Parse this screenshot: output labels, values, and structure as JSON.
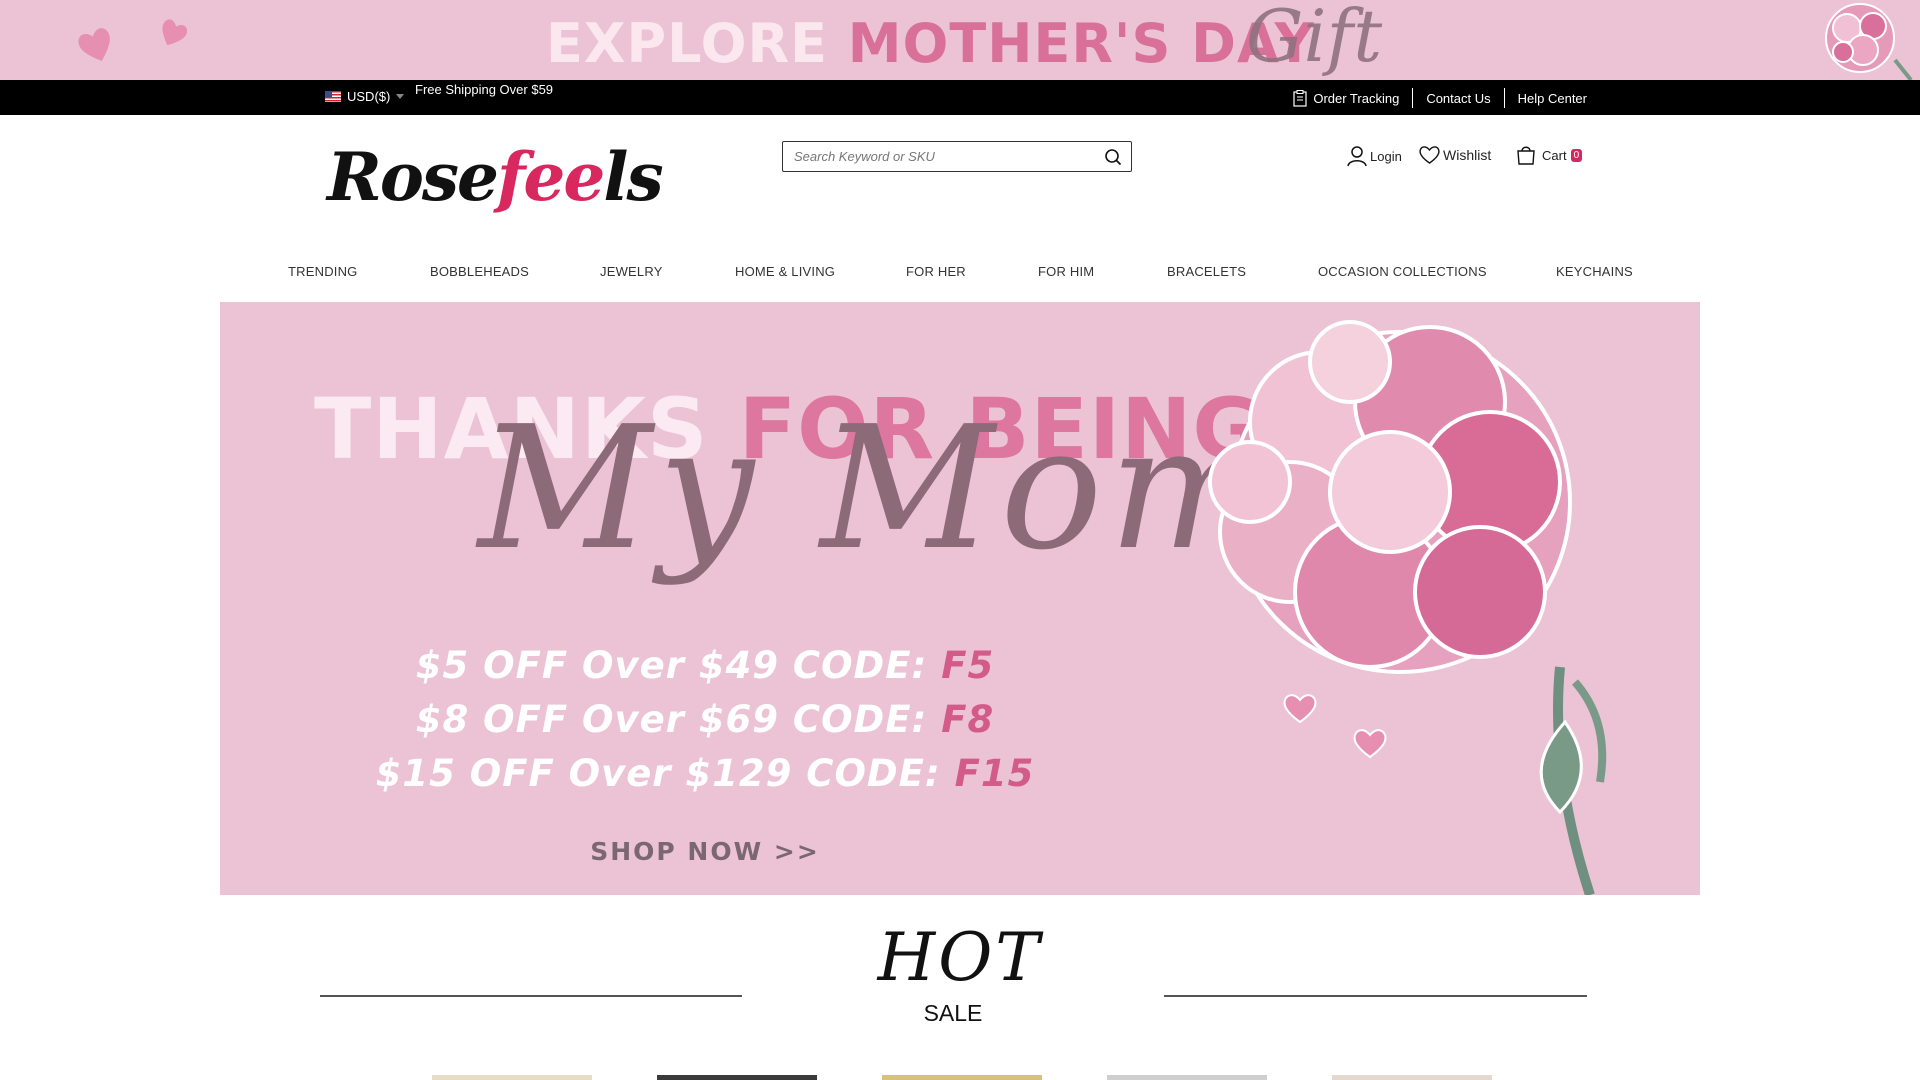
{
  "promo": {
    "word1": "EXPLORE",
    "word2": "MOTHER'S DAY",
    "script": "Gift"
  },
  "topbar": {
    "currency": "USD($)",
    "shipping": "Free Shipping Over $59",
    "links": {
      "order_tracking": "Order Tracking",
      "contact_us": "Contact Us",
      "help_center": "Help Center"
    }
  },
  "header": {
    "logo_part1": "Rose",
    "logo_part2": "fee",
    "logo_part3": "ls",
    "search_placeholder": "Search Keyword or SKU",
    "login": "Login",
    "wishlist": "Wishlist",
    "cart": "Cart",
    "cart_count": "0"
  },
  "nav": {
    "trending": "TRENDING",
    "bobbleheads": "BOBBLEHEADS",
    "jewelry": "JEWELRY",
    "home_living": "HOME & LIVING",
    "for_her": "FOR HER",
    "for_him": "FOR HIM",
    "bracelets": "BRACELETS",
    "occasion": "OCCASION COLLECTIONS",
    "keychains": "KEYCHAINS"
  },
  "hero": {
    "word1": "THANKS",
    "word2": "FOR BEING",
    "script": "My Mom",
    "code1_text": "$5 OFF Over $49 CODE:",
    "code1": "F5",
    "code2_text": "$8 OFF Over $69 CODE:",
    "code2": "F8",
    "code3_text": "$15 OFF Over $129 CODE:",
    "code3": "F15",
    "cta": "SHOP NOW >>"
  },
  "hot_sale": {
    "title": "HOT",
    "subtitle": "SALE"
  },
  "colors": {
    "banner_pink": "#ecc3d5",
    "accent_pink": "#d8285f",
    "topbar": "#000000"
  }
}
